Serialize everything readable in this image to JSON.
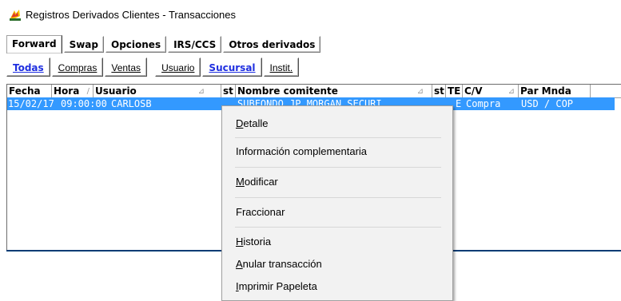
{
  "window": {
    "title": "Registros Derivados Clientes - Transacciones",
    "icon": "app-logo-icon",
    "icon_color": "#f5c800"
  },
  "product_tabs": [
    "Forward",
    "Swap",
    "Opciones",
    "IRS/CCS",
    "Otros derivados"
  ],
  "active_product_tab": "Forward",
  "filter_group_1": [
    "Todas",
    "Compras",
    "Ventas"
  ],
  "filter_group_2": [
    "Usuario",
    "Sucursal",
    "Instit."
  ],
  "selected_filters": [
    "Todas",
    "Sucursal"
  ],
  "grid": {
    "columns": [
      "Fecha",
      "Hora",
      "Usuario",
      "st",
      "Nombre comitente",
      "st",
      "TE",
      "C/V",
      "Par Mnda"
    ],
    "rows": [
      {
        "fecha": "15/02/17",
        "hora": "09:00:00",
        "usuario": "CARLOSB",
        "nombre": "SUBFONDO JP MORGAN SECURI",
        "te": "E",
        "cv": "Compra",
        "par": "USD / COP"
      }
    ]
  },
  "context_menu": [
    {
      "label": "Detalle",
      "mnemonic": "D"
    },
    {
      "label": "Información complementaria",
      "mnemonic": ""
    },
    {
      "label": "Modificar",
      "mnemonic": "M"
    },
    {
      "label": "Fraccionar",
      "mnemonic": ""
    },
    {
      "label": "Historia",
      "mnemonic": "H"
    },
    {
      "label": "Anular transacción",
      "mnemonic": "A"
    },
    {
      "label": "Imprimir Papeleta",
      "mnemonic": "I"
    }
  ],
  "colors": {
    "selection": "#3399ff",
    "filter_selected": "#1f2fe0",
    "menu_background": "#f2f2f2"
  }
}
